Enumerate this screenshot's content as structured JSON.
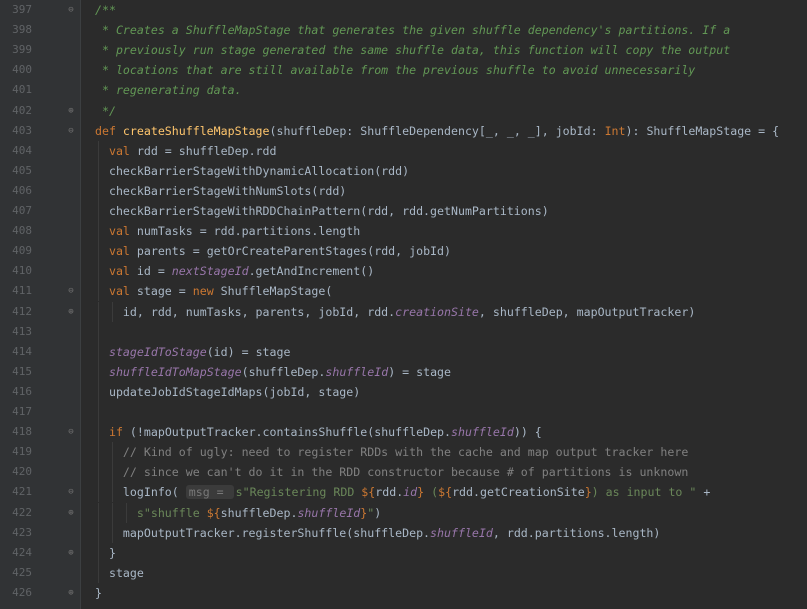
{
  "editor": {
    "lines": [
      {
        "num": "397",
        "fold": "open",
        "guides": 0,
        "segments": [
          {
            "t": "/**",
            "c": "doc"
          }
        ]
      },
      {
        "num": "398",
        "fold": "",
        "guides": 0,
        "segments": [
          {
            "t": " * Creates a ShuffleMapStage that generates the given shuffle dependency's partitions. If a",
            "c": "doc"
          }
        ]
      },
      {
        "num": "399",
        "fold": "",
        "guides": 0,
        "segments": [
          {
            "t": " * previously run stage generated the same shuffle data, this function will copy the output",
            "c": "doc"
          }
        ]
      },
      {
        "num": "400",
        "fold": "",
        "guides": 0,
        "segments": [
          {
            "t": " * locations that are still available from the previous shuffle to avoid unnecessarily",
            "c": "doc"
          }
        ]
      },
      {
        "num": "401",
        "fold": "",
        "guides": 0,
        "segments": [
          {
            "t": " * regenerating data.",
            "c": "doc"
          }
        ]
      },
      {
        "num": "402",
        "fold": "close",
        "guides": 0,
        "segments": [
          {
            "t": " */",
            "c": "doc"
          }
        ]
      },
      {
        "num": "403",
        "fold": "open",
        "guides": 0,
        "segments": [
          {
            "t": "def ",
            "c": "kw"
          },
          {
            "t": "createShuffleMapStage",
            "c": "fn"
          },
          {
            "t": "(shuffleDep: ShuffleDependency[_, _, _], jobId: ",
            "c": "plain"
          },
          {
            "t": "Int",
            "c": "kw"
          },
          {
            "t": "): ShuffleMapStage = {",
            "c": "plain"
          }
        ]
      },
      {
        "num": "404",
        "fold": "",
        "guides": 1,
        "segments": [
          {
            "t": "  ",
            "c": "plain"
          },
          {
            "t": "val ",
            "c": "kw"
          },
          {
            "t": "rdd = shuffleDep.rdd",
            "c": "plain"
          }
        ]
      },
      {
        "num": "405",
        "fold": "",
        "guides": 1,
        "segments": [
          {
            "t": "  checkBarrierStageWithDynamicAllocation(rdd)",
            "c": "plain"
          }
        ]
      },
      {
        "num": "406",
        "fold": "",
        "guides": 1,
        "segments": [
          {
            "t": "  checkBarrierStageWithNumSlots(rdd)",
            "c": "plain"
          }
        ]
      },
      {
        "num": "407",
        "fold": "",
        "guides": 1,
        "segments": [
          {
            "t": "  checkBarrierStageWithRDDChainPattern(rdd, rdd.getNumPartitions)",
            "c": "plain"
          }
        ]
      },
      {
        "num": "408",
        "fold": "",
        "guides": 1,
        "segments": [
          {
            "t": "  ",
            "c": "plain"
          },
          {
            "t": "val ",
            "c": "kw"
          },
          {
            "t": "numTasks = rdd.partitions.length",
            "c": "plain"
          }
        ]
      },
      {
        "num": "409",
        "fold": "",
        "guides": 1,
        "segments": [
          {
            "t": "  ",
            "c": "plain"
          },
          {
            "t": "val ",
            "c": "kw"
          },
          {
            "t": "parents = getOrCreateParentStages(rdd, jobId)",
            "c": "plain"
          }
        ]
      },
      {
        "num": "410",
        "fold": "",
        "guides": 1,
        "segments": [
          {
            "t": "  ",
            "c": "plain"
          },
          {
            "t": "val ",
            "c": "kw"
          },
          {
            "t": "id = ",
            "c": "plain"
          },
          {
            "t": "nextStageId",
            "c": "ital"
          },
          {
            "t": ".getAndIncrement()",
            "c": "plain"
          }
        ]
      },
      {
        "num": "411",
        "fold": "open",
        "guides": 1,
        "segments": [
          {
            "t": "  ",
            "c": "plain"
          },
          {
            "t": "val ",
            "c": "kw"
          },
          {
            "t": "stage = ",
            "c": "plain"
          },
          {
            "t": "new ",
            "c": "kw"
          },
          {
            "t": "ShuffleMapStage(",
            "c": "plain"
          }
        ]
      },
      {
        "num": "412",
        "fold": "close",
        "guides": 2,
        "segments": [
          {
            "t": "    id, rdd, numTasks, parents, jobId, rdd.",
            "c": "plain"
          },
          {
            "t": "creationSite",
            "c": "ital"
          },
          {
            "t": ", shuffleDep, mapOutputTracker)",
            "c": "plain"
          }
        ]
      },
      {
        "num": "413",
        "fold": "",
        "guides": 1,
        "segments": []
      },
      {
        "num": "414",
        "fold": "",
        "guides": 1,
        "segments": [
          {
            "t": "  ",
            "c": "plain"
          },
          {
            "t": "stageIdToStage",
            "c": "ital"
          },
          {
            "t": "(id) = stage",
            "c": "plain"
          }
        ]
      },
      {
        "num": "415",
        "fold": "",
        "guides": 1,
        "segments": [
          {
            "t": "  ",
            "c": "plain"
          },
          {
            "t": "shuffleIdToMapStage",
            "c": "ital"
          },
          {
            "t": "(shuffleDep.",
            "c": "plain"
          },
          {
            "t": "shuffleId",
            "c": "ital"
          },
          {
            "t": ") = stage",
            "c": "plain"
          }
        ]
      },
      {
        "num": "416",
        "fold": "",
        "guides": 1,
        "segments": [
          {
            "t": "  updateJobIdStageIdMaps(jobId, stage)",
            "c": "plain"
          }
        ]
      },
      {
        "num": "417",
        "fold": "",
        "guides": 1,
        "segments": []
      },
      {
        "num": "418",
        "fold": "open",
        "guides": 1,
        "segments": [
          {
            "t": "  ",
            "c": "plain"
          },
          {
            "t": "if ",
            "c": "kw"
          },
          {
            "t": "(!mapOutputTracker.containsShuffle(shuffleDep.",
            "c": "plain"
          },
          {
            "t": "shuffleId",
            "c": "ital"
          },
          {
            "t": ")) {",
            "c": "plain"
          }
        ]
      },
      {
        "num": "419",
        "fold": "",
        "guides": 2,
        "segments": [
          {
            "t": "    ",
            "c": "plain"
          },
          {
            "t": "// Kind of ugly: need to register RDDs with the cache and map output tracker here",
            "c": "cm"
          }
        ]
      },
      {
        "num": "420",
        "fold": "",
        "guides": 2,
        "segments": [
          {
            "t": "    ",
            "c": "plain"
          },
          {
            "t": "// since we can't do it in the RDD constructor because # of partitions is unknown",
            "c": "cm"
          }
        ]
      },
      {
        "num": "421",
        "fold": "open",
        "guides": 2,
        "segments": [
          {
            "t": "    logInfo( ",
            "c": "plain"
          },
          {
            "t": "msg = ",
            "c": "hint"
          },
          {
            "t": "s\"Registering RDD ",
            "c": "str"
          },
          {
            "t": "${",
            "c": "kw"
          },
          {
            "t": "rdd.",
            "c": "plain"
          },
          {
            "t": "id",
            "c": "ital"
          },
          {
            "t": "}",
            "c": "kw"
          },
          {
            "t": " (",
            "c": "str"
          },
          {
            "t": "${",
            "c": "kw"
          },
          {
            "t": "rdd.getCreationSite",
            "c": "plain"
          },
          {
            "t": "}",
            "c": "kw"
          },
          {
            "t": ") as input to \" ",
            "c": "str"
          },
          {
            "t": "+",
            "c": "plain"
          }
        ]
      },
      {
        "num": "422",
        "fold": "close",
        "guides": 3,
        "segments": [
          {
            "t": "      ",
            "c": "plain"
          },
          {
            "t": "s\"shuffle ",
            "c": "str"
          },
          {
            "t": "${",
            "c": "kw"
          },
          {
            "t": "shuffleDep.",
            "c": "plain"
          },
          {
            "t": "shuffleId",
            "c": "ital"
          },
          {
            "t": "}",
            "c": "kw"
          },
          {
            "t": "\"",
            "c": "str"
          },
          {
            "t": ")",
            "c": "plain"
          }
        ]
      },
      {
        "num": "423",
        "fold": "",
        "guides": 2,
        "segments": [
          {
            "t": "    mapOutputTracker.registerShuffle(shuffleDep.",
            "c": "plain"
          },
          {
            "t": "shuffleId",
            "c": "ital"
          },
          {
            "t": ", rdd.partitions.length)",
            "c": "plain"
          }
        ]
      },
      {
        "num": "424",
        "fold": "close",
        "guides": 1,
        "segments": [
          {
            "t": "  }",
            "c": "plain"
          }
        ]
      },
      {
        "num": "425",
        "fold": "",
        "guides": 1,
        "segments": [
          {
            "t": "  stage",
            "c": "plain"
          }
        ]
      },
      {
        "num": "426",
        "fold": "close",
        "guides": 0,
        "segments": [
          {
            "t": "}",
            "c": "plain"
          }
        ]
      }
    ]
  }
}
